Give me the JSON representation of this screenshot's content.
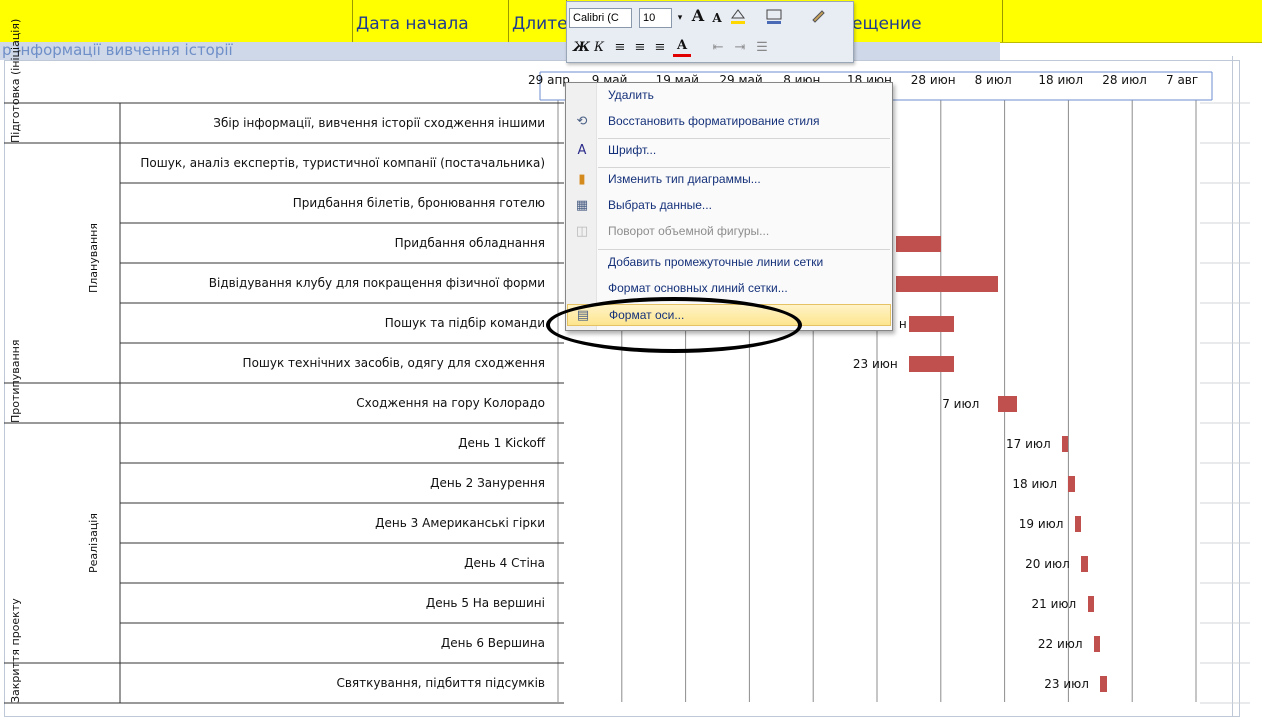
{
  "sheet_header": {
    "col_start": "Дата начала",
    "col_duration_partial": "Длите",
    "col_offset_partial": "ещение",
    "row2_faded": "р інформації вивчення історії"
  },
  "mini_toolbar": {
    "font_name": "Calibri (С",
    "font_size": "10",
    "grow_font": "A",
    "shrink_font": "A",
    "bold": "Ж",
    "italic": "К",
    "font_color_letter": "A"
  },
  "context_menu": {
    "items": [
      {
        "label": "Удалить",
        "icon": "",
        "disabled": false
      },
      {
        "label": "Восстановить форматирование стиля",
        "icon": "reset-style-icon",
        "disabled": false
      },
      {
        "label": "Шрифт...",
        "icon": "font-icon",
        "disabled": false
      },
      {
        "label": "Изменить тип диаграммы...",
        "icon": "chart-type-icon",
        "disabled": false
      },
      {
        "label": "Выбрать данные...",
        "icon": "select-data-icon",
        "disabled": false
      },
      {
        "label": "Поворот объемной фигуры...",
        "icon": "3d-rotation-icon",
        "disabled": true
      },
      {
        "label": "Добавить промежуточные линии сетки",
        "icon": "",
        "disabled": false
      },
      {
        "label": "Формат основных линий сетки...",
        "icon": "",
        "disabled": false
      },
      {
        "label": "Формат оси...",
        "icon": "format-axis-icon",
        "disabled": false,
        "highlighted": true
      }
    ]
  },
  "chart_data": {
    "type": "bar",
    "orientation": "horizontal-gantt",
    "x_ticks": [
      "29 апр",
      "9 май",
      "19 май",
      "29 май",
      "8 июн",
      "18 июн",
      "28 июн",
      "8 июл",
      "18 июл",
      "28 июл",
      "7 авг"
    ],
    "groups": [
      {
        "name": "Підготовка (ініціація)",
        "tasks": [
          "Збір інформації,  вивчення історії сходження іншими"
        ]
      },
      {
        "name": "Планування",
        "tasks": [
          "Пошук, аналіз експертів, туристичної компанії (постачальника)",
          "Придбання білетів, бронювання готелю",
          "Придбання обладнання",
          "Відвідування клубу для покращення фізичної форми",
          "Пошук та підбір команди",
          "Пошук технічних засобів, одягу для сходження"
        ]
      },
      {
        "name": "Протипування",
        "tasks": [
          "Сходження на гору Колорадо"
        ]
      },
      {
        "name": "Реалізація",
        "tasks": [
          "День 1 Kickoff",
          "День 2 Занурення",
          "День 3 Американські гірки",
          "День 4 Стіна",
          "День 5 На вершині",
          "День 6 Вершина"
        ]
      },
      {
        "name": "Закриття проекту",
        "tasks": [
          "Святкування, підбиття підсумків"
        ]
      }
    ],
    "bars": [
      {
        "task": "Придбання обладнання",
        "start": "2014-06-21",
        "end": "2014-06-28",
        "label": ""
      },
      {
        "task": "Відвідування клубу для покращення фізичної форми",
        "start": "2014-06-21",
        "end": "2014-07-07",
        "label": ""
      },
      {
        "task": "Пошук та підбір команди",
        "start": "2014-06-23",
        "end": "2014-06-30",
        "label": "н"
      },
      {
        "task": "Пошук технічних засобів, одягу для сходження",
        "start": "2014-06-23",
        "end": "2014-06-30",
        "label": "23 июн"
      },
      {
        "task": "Сходження на гору Колорадо",
        "start": "2014-07-07",
        "end": "2014-07-10",
        "label": "7 июл"
      },
      {
        "task": "День 1 Kickoff",
        "start": "2014-07-17",
        "end": "2014-07-18",
        "label": "17 июл"
      },
      {
        "task": "День 2 Занурення",
        "start": "2014-07-18",
        "end": "2014-07-19",
        "label": "18 июл"
      },
      {
        "task": "День 3 Американські гірки",
        "start": "2014-07-19",
        "end": "2014-07-20",
        "label": "19 июл"
      },
      {
        "task": "День 4 Стіна",
        "start": "2014-07-20",
        "end": "2014-07-21",
        "label": "20 июл"
      },
      {
        "task": "День 5 На вершині",
        "start": "2014-07-21",
        "end": "2014-07-22",
        "label": "21 июл"
      },
      {
        "task": "День 6 Вершина",
        "start": "2014-07-22",
        "end": "2014-07-23",
        "label": "22 июл"
      },
      {
        "task": "Святкування, підбиття підсумків",
        "start": "2014-07-23",
        "end": "2014-07-24",
        "label": "23 июл"
      }
    ],
    "bar_color": "#c0504d",
    "gridlines": "vertical-major"
  }
}
